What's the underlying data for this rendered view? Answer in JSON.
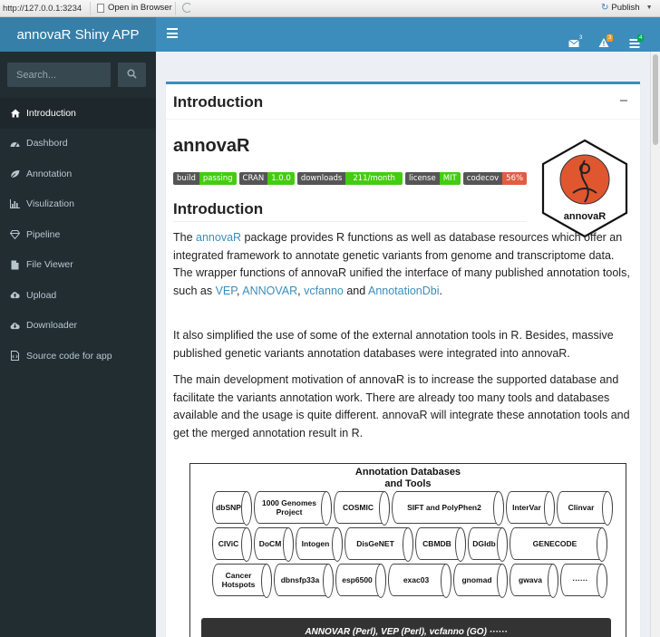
{
  "browser": {
    "url": "http://127.0.0.1:3234",
    "open_in_browser": "Open in Browser",
    "publish": "Publish"
  },
  "header": {
    "app_title": "annovaR Shiny APP",
    "badges": {
      "messages": "3",
      "notifications": "3",
      "tasks": "4"
    }
  },
  "sidebar": {
    "search_placeholder": "Search...",
    "items": [
      {
        "label": "Introduction",
        "icon": "home-icon",
        "active": true
      },
      {
        "label": "Dashbord",
        "icon": "dashboard-icon"
      },
      {
        "label": "Annotation",
        "icon": "leaf-icon"
      },
      {
        "label": "Visulization",
        "icon": "bar-chart-icon"
      },
      {
        "label": "Pipeline",
        "icon": "diamond-icon"
      },
      {
        "label": "File Viewer",
        "icon": "file-icon"
      },
      {
        "label": "Upload",
        "icon": "cloud-upload-icon"
      },
      {
        "label": "Downloader",
        "icon": "cloud-download-icon"
      },
      {
        "label": "Source code for app",
        "icon": "file-code-icon"
      }
    ]
  },
  "main": {
    "box_title": "Introduction",
    "package_title": "annovaR",
    "shields": [
      {
        "label": "build",
        "value": "passing",
        "color": "#4c1"
      },
      {
        "label": "CRAN",
        "value": "1.0.0",
        "color": "#4c1"
      },
      {
        "label": "downloads",
        "value": "211/month",
        "color": "#4c1"
      },
      {
        "label": "license",
        "value": "MIT",
        "color": "#4c1"
      },
      {
        "label": "codecov",
        "value": "56%",
        "color": "#e05d44"
      }
    ],
    "hex_logo_text": "annovaR",
    "section_heading": "Introduction",
    "p1": {
      "a": "The ",
      "link1": "annovaR",
      "b": " package provides R functions as well as database resources which offer an integrated framework to annotate genetic variants from genome and transcriptome data. The wrapper functions of annovaR unified the interface of many published annotation tools, such as ",
      "link2": "VEP",
      "c": ", ",
      "link3": "ANNOVAR",
      "d": ", ",
      "link4": "vcfanno",
      "e": " and ",
      "link5": "AnnotationDbi",
      "f": "."
    },
    "p2": "It also simplified the use of some of the external annotation tools in R. Besides, massive published genetic variants annotation databases were integrated into annovaR.",
    "p3": "The main development motivation of annovaR is to increase the supported database and facilitate the variants annotation work. There are already too many tools and databases available and the usage is quite different. annovaR will integrate these annotation tools and get the merged annotation result in R."
  },
  "diagram": {
    "title_line1": "Annotation Databases",
    "title_line2": "and Tools",
    "row1": [
      "dbSNP",
      "1000 Genomes Project",
      "COSMIC",
      "SIFT and PolyPhen2",
      "InterVar",
      "Clinvar"
    ],
    "row2": [
      "CIViC",
      "DoCM",
      "Intogen",
      "DisGeNET",
      "CBMDB",
      "DGIdb",
      "GENECODE"
    ],
    "row3": [
      "Cancer Hotspots",
      "dbnsfp33a",
      "esp6500",
      "exac03",
      "gnomad",
      "gwava",
      "······"
    ],
    "tools": "ANNOVAR (Perl), VEP (Perl), vcfanno (GO) ······"
  }
}
